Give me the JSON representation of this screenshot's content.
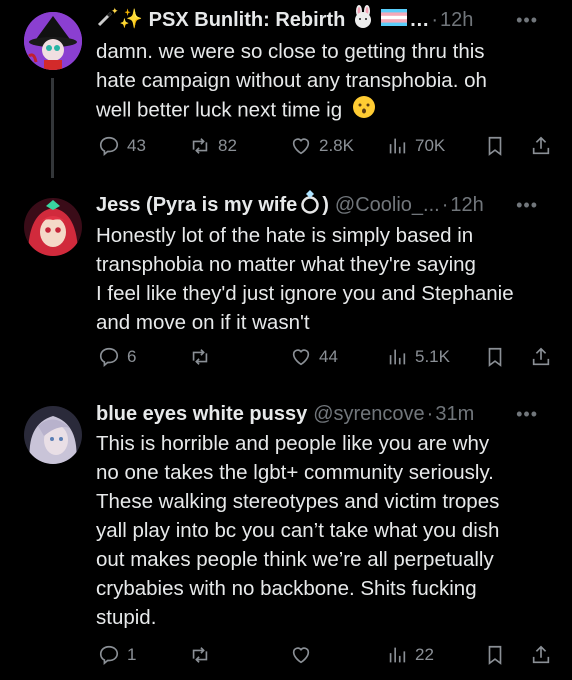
{
  "tweets": [
    {
      "display_name": "PSX Bunlith: Rebirth",
      "handle": "",
      "time": "12h",
      "dot": "…",
      "lines": [
        "damn. we were so close to getting thru this",
        "hate campaign without any transphobia. oh",
        "well better luck next time ig"
      ],
      "replies": "43",
      "retweets": "82",
      "likes": "2.8K",
      "views": "70K",
      "icons": [
        "magic-wand-icon",
        "sparkles-icon",
        "rabbit-emoji-icon",
        "trans-flag-icon",
        "hushed-face-emoji-icon"
      ]
    },
    {
      "display_name": "Jess (Pyra is my wife",
      "name_suffix": ")",
      "handle": "@Coolio_...",
      "time": "12h",
      "lines": [
        "Honestly lot of the hate is simply based in",
        "transphobia no matter what they're saying",
        "I feel like they'd just ignore you and Stephanie",
        "and move on if it wasn't"
      ],
      "replies": "6",
      "retweets": "",
      "likes": "44",
      "views": "5.1K",
      "icons": [
        "ring-emoji-icon"
      ]
    },
    {
      "display_name": "blue eyes white pussy",
      "handle": "@syrencove",
      "time": "31m",
      "lines": [
        "This is horrible and people like you are why",
        "no one takes the lgbt+ community seriously.",
        "These walking stereotypes and victim tropes",
        "yall play into bc you can’t take what you dish",
        "out makes people think we’re all perpetually",
        "crybabies with no backbone. Shits fucking",
        "stupid."
      ],
      "replies": "1",
      "retweets": "",
      "likes": "",
      "views": "22"
    }
  ],
  "colors": {
    "background": "#000000",
    "text": "#e7e9ea",
    "muted": "#71767b",
    "thread": "#333639"
  }
}
